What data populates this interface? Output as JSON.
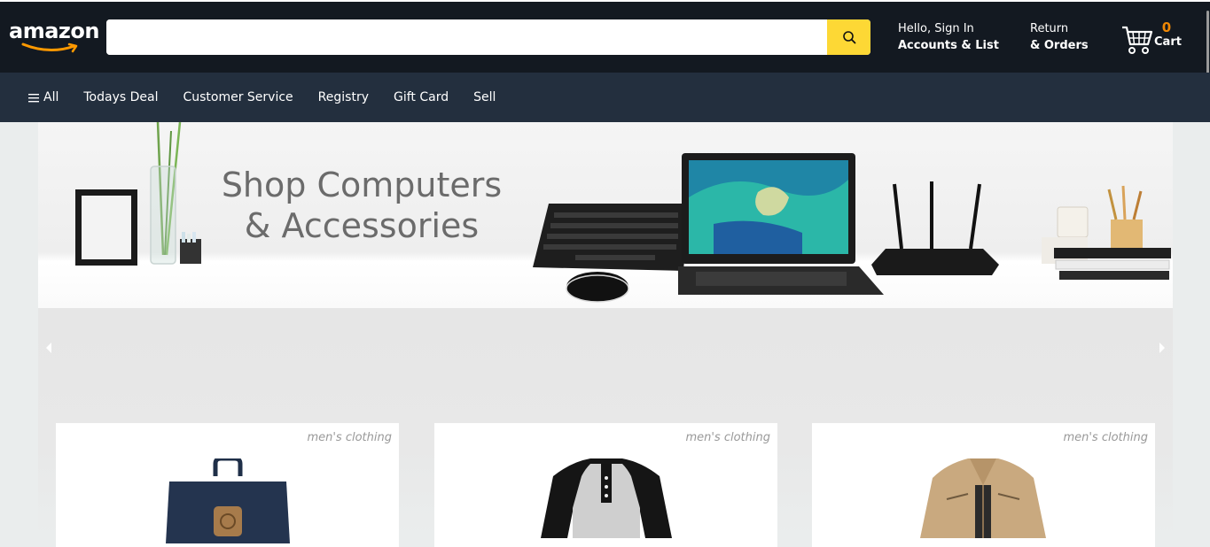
{
  "header": {
    "logo_text": "amazon",
    "search": {
      "value": "",
      "placeholder": ""
    },
    "account": {
      "line1": "Hello, Sign In",
      "line2": "Accounts & List"
    },
    "orders": {
      "line1": "Return",
      "line2": "& Orders"
    },
    "cart": {
      "count": "0",
      "label": "Cart"
    }
  },
  "nav": {
    "items": [
      {
        "label": "All",
        "icon": "hamburger-icon"
      },
      {
        "label": "Todays Deal"
      },
      {
        "label": "Customer Service"
      },
      {
        "label": "Registry"
      },
      {
        "label": "Gift Card"
      },
      {
        "label": "Sell"
      }
    ]
  },
  "hero": {
    "title_line1": "Shop Computers",
    "title_line2": "& Accessories"
  },
  "products": [
    {
      "category": "men's clothing",
      "image": "backpack"
    },
    {
      "category": "men's clothing",
      "image": "raglan-shirt"
    },
    {
      "category": "men's clothing",
      "image": "jacket"
    }
  ],
  "colors": {
    "topbar": "#131921",
    "navbar": "#232f3e",
    "search_button": "#fdd835",
    "cart_count": "#f08804"
  }
}
